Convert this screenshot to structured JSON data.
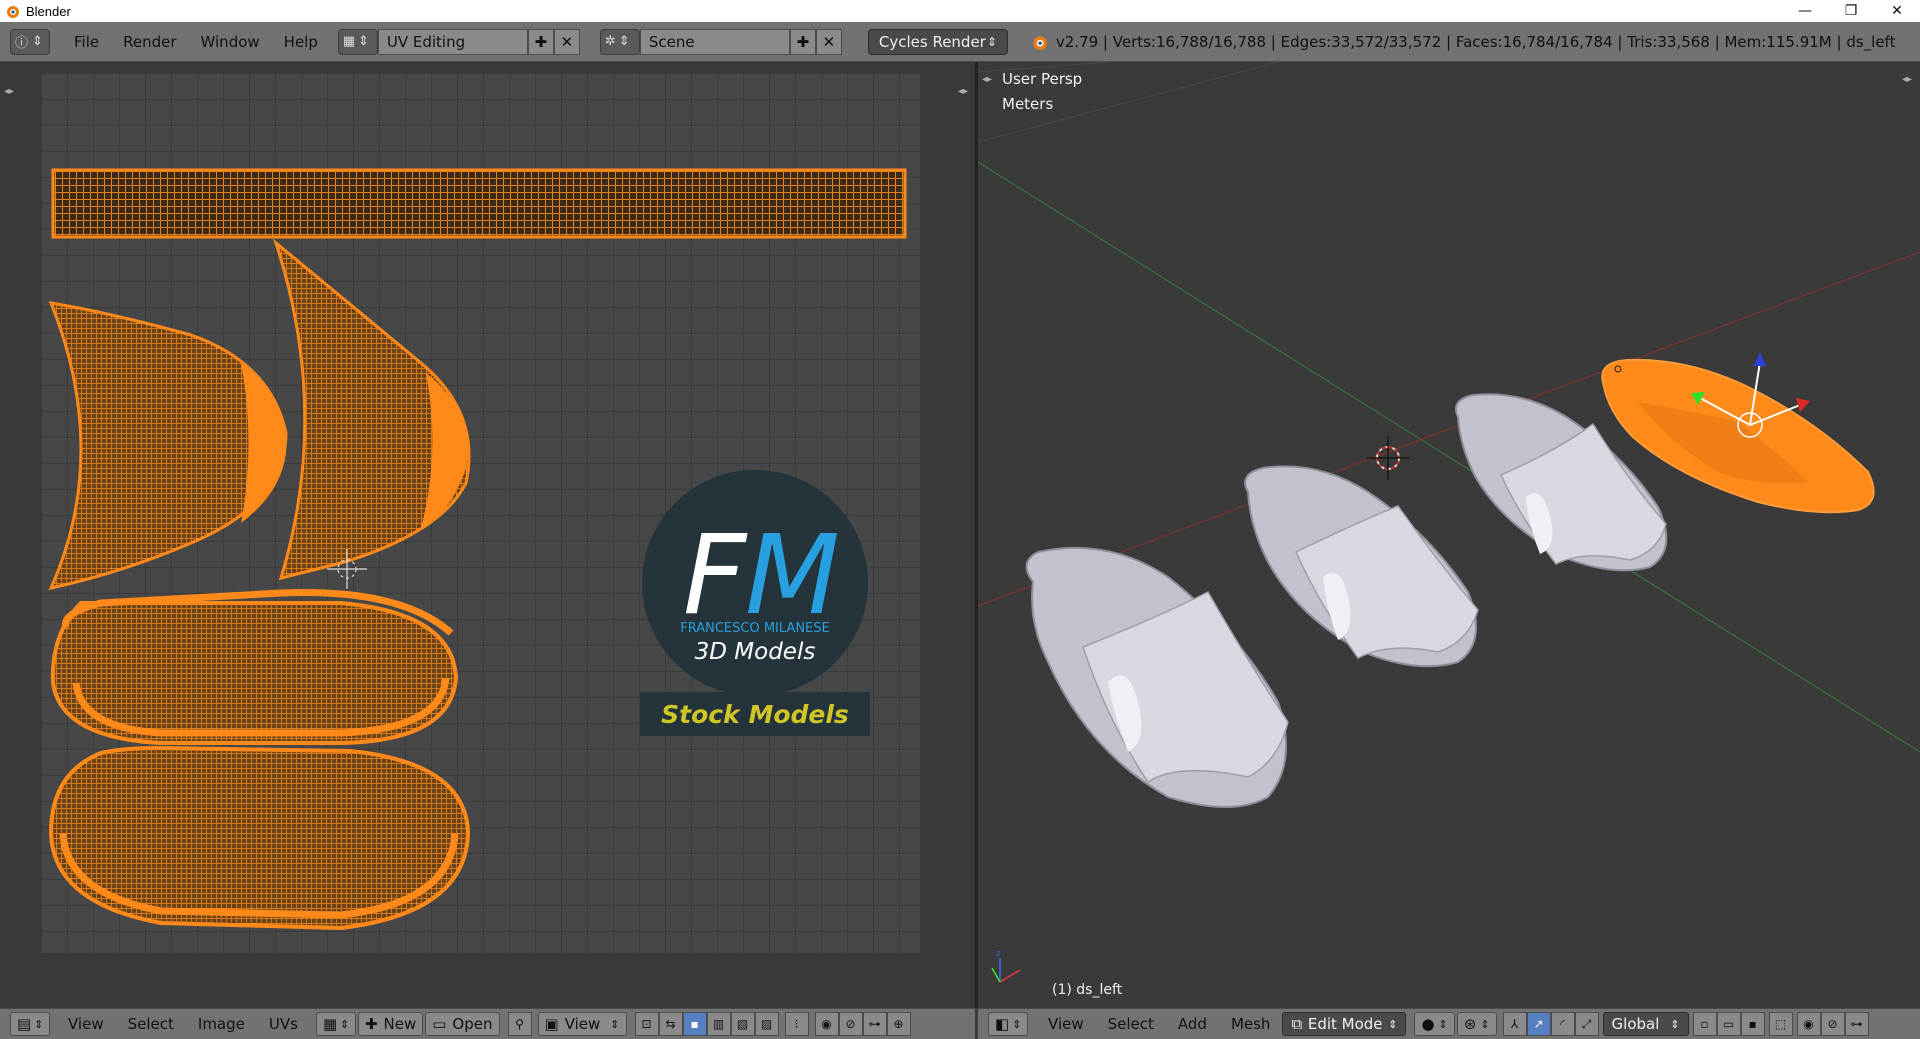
{
  "window": {
    "title": "Blender",
    "controls": {
      "minimize": "—",
      "maximize": "❐",
      "close": "✕"
    }
  },
  "topbar": {
    "menus": [
      "File",
      "Render",
      "Window",
      "Help"
    ],
    "screen_layout": "UV Editing",
    "scene": "Scene",
    "render_engine": "Cycles Render",
    "stats": "v2.79 | Verts:16,788/16,788 | Edges:33,572/33,572 | Faces:16,784/16,784 | Tris:33,568 | Mem:115.91M | ds_left"
  },
  "uv_editor": {
    "logo": {
      "initials_f": "F",
      "initials_m": "M",
      "company": "FRANCESCO MILANESE",
      "subtitle": "3D Models",
      "banner": "Stock Models"
    },
    "bottombar": {
      "menus": [
        "View",
        "Select",
        "Image",
        "UVs"
      ],
      "new_label": "New",
      "open_label": "Open",
      "view_label": "View"
    }
  },
  "viewport": {
    "perspective": "User Persp",
    "units": "Meters",
    "object_label": "(1) ds_left",
    "bottombar": {
      "menus": [
        "View",
        "Select",
        "Add",
        "Mesh"
      ],
      "mode": "Edit Mode",
      "orientation": "Global"
    }
  },
  "colors": {
    "uv_orange": "#ff8a1a",
    "slipper_white": "#d2d2da",
    "accent_blue": "#5680c2"
  }
}
